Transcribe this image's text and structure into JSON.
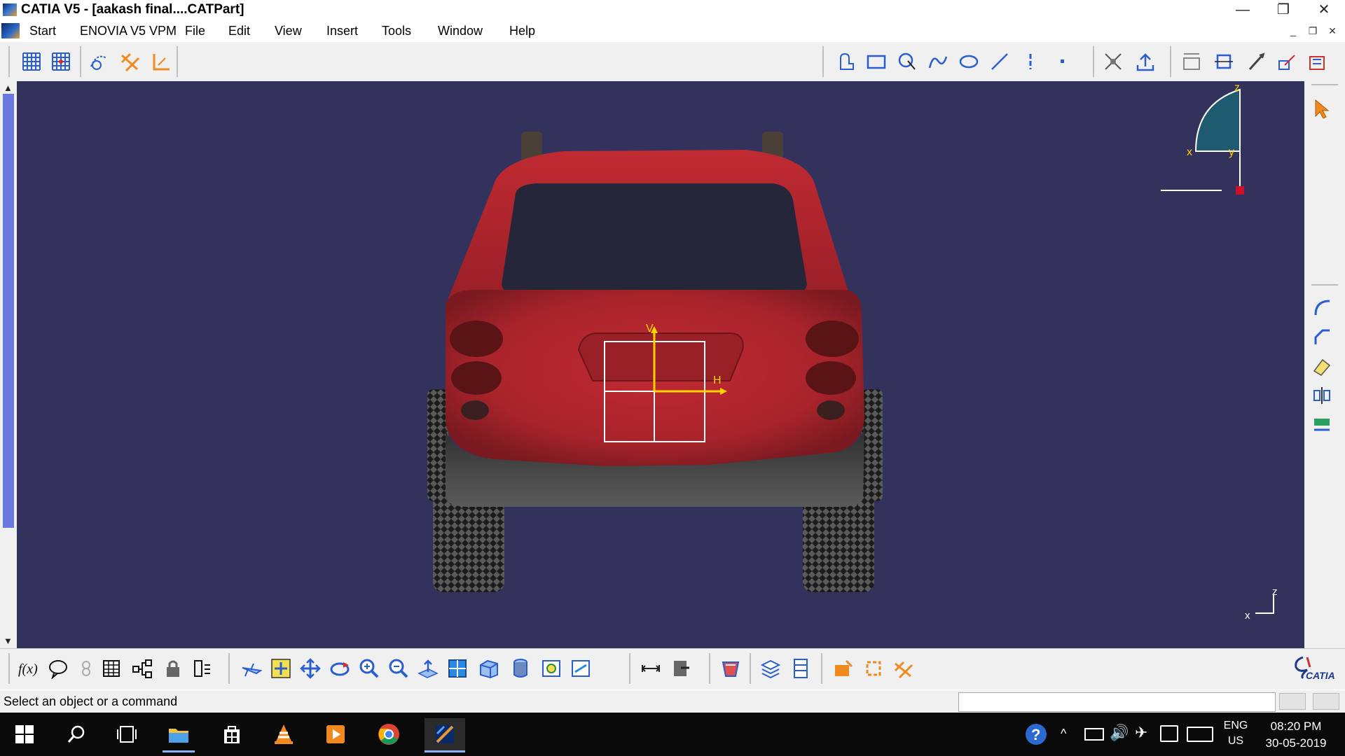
{
  "window": {
    "title": "CATIA V5 - [aakash final....CATPart]",
    "minimize": "—",
    "restore": "❐",
    "close": "✕"
  },
  "menu": {
    "items": [
      "Start",
      "ENOVIA V5 VPM",
      "File",
      "Edit",
      "View",
      "Insert",
      "Tools",
      "Window",
      "Help"
    ],
    "mdi_minimize": "_",
    "mdi_restore": "❐",
    "mdi_close": "✕"
  },
  "viewport": {
    "compass_z": "z",
    "compass_x": "x",
    "compass_y": "y",
    "axis_v": "V",
    "axis_h": "H",
    "triad_z": "z",
    "triad_x": "x"
  },
  "brand": {
    "logo_text": "CATIA"
  },
  "status": {
    "message": "Select an object or a command",
    "input_value": ""
  },
  "taskbar": {
    "lang_top": "ENG",
    "lang_bottom": "US",
    "time": "08:20 PM",
    "date": "30-05-2019"
  },
  "colors": {
    "viewport_bg": "#33325c",
    "car_red": "#b8272e",
    "sketch_axis": "#ffd200"
  }
}
